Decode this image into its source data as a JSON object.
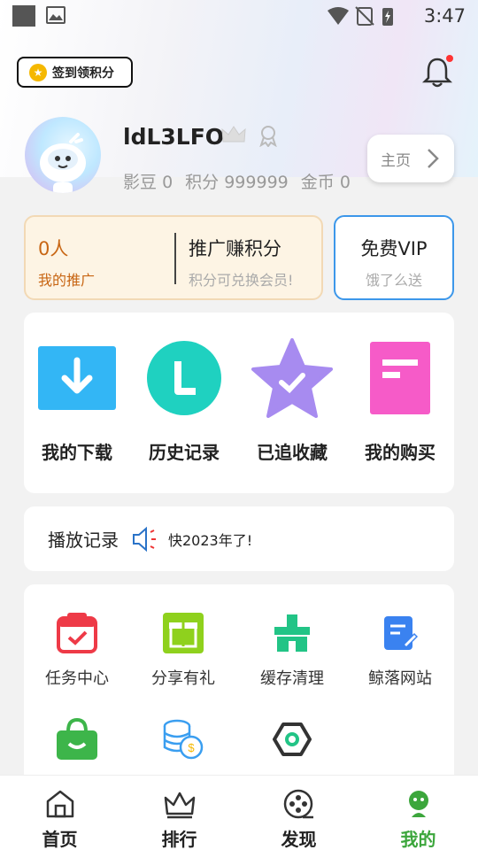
{
  "status_bar": {
    "time": "3:47"
  },
  "header": {
    "signin_label": "签到领积分"
  },
  "profile": {
    "username": "ldL3LFO",
    "stats": [
      {
        "label": "影豆",
        "value": "0"
      },
      {
        "label": "积分",
        "value": "999999"
      },
      {
        "label": "金币",
        "value": "0"
      }
    ],
    "home_label": "主页"
  },
  "promo": {
    "count": "0人",
    "count_label": "我的推广",
    "title": "推广赚积分",
    "subtitle": "积分可兑换会员!"
  },
  "vip": {
    "title": "免费VIP",
    "subtitle": "饿了么送"
  },
  "quick_actions": [
    {
      "label": "我的下载",
      "icon": "download-icon",
      "color": "#33b6f5"
    },
    {
      "label": "历史记录",
      "icon": "history-icon",
      "color": "#1fd1c0"
    },
    {
      "label": "已追收藏",
      "icon": "favorite-star-icon",
      "color": "#a78bf0"
    },
    {
      "label": "我的购买",
      "icon": "purchase-icon",
      "color": "#f65bc8"
    }
  ],
  "play_record": {
    "label": "播放记录",
    "text": "快2023年了!"
  },
  "grid": [
    {
      "label": "任务中心",
      "icon": "task-center-icon",
      "color": "#ee3a47"
    },
    {
      "label": "分享有礼",
      "icon": "gift-icon",
      "color": "#8fd11d"
    },
    {
      "label": "缓存清理",
      "icon": "cache-clean-icon",
      "color": "#22c486"
    },
    {
      "label": "鲸落网站",
      "icon": "website-icon",
      "color": "#3a82f0"
    },
    {
      "label": "",
      "icon": "shop-bag-icon",
      "color": "#3db54a"
    },
    {
      "label": "",
      "icon": "coins-icon",
      "color": "#3a9ef0"
    },
    {
      "label": "",
      "icon": "settings-hex-icon",
      "color": "#333333"
    }
  ],
  "bottom_nav": [
    {
      "label": "首页",
      "icon": "home-icon"
    },
    {
      "label": "排行",
      "icon": "ranking-crown-icon"
    },
    {
      "label": "发现",
      "icon": "discover-film-icon"
    },
    {
      "label": "我的",
      "icon": "profile-icon",
      "active": true
    }
  ]
}
